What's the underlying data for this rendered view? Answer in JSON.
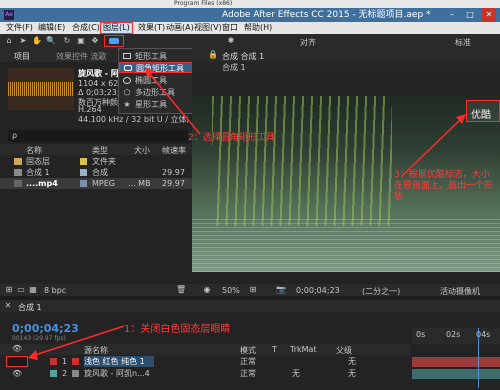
{
  "window": {
    "title": "Adobe After Effects CC 2015 - 无标题项目.aep *",
    "background_path": "Program Files (x86)"
  },
  "menubar": {
    "items": [
      "文件(F)",
      "编辑(E)",
      "合成(C)",
      "图层(L)",
      "效果(T)",
      "动画(A)",
      "视图(V)",
      "窗口",
      "帮助(H)"
    ]
  },
  "toolbar": {
    "snap_label": "对齐",
    "workspace_label": "标准"
  },
  "shape_menu": {
    "items": [
      {
        "label": "矩形工具",
        "shortcut": "Q"
      },
      {
        "label": "圆角矩形工具",
        "shortcut": "Q"
      },
      {
        "label": "椭圆工具",
        "shortcut": "Q"
      },
      {
        "label": "多边形工具",
        "shortcut": "Q"
      },
      {
        "label": "星形工具",
        "shortcut": "Q"
      }
    ]
  },
  "project_panel": {
    "title": "项目",
    "effects_tab": "效果控件 流歌",
    "preview_name": "旋风歌 - 阿凯n",
    "preview_info1": "1104 x 622 (1.",
    "preview_info2": "Δ 0;03;23;07,",
    "preview_info3": "数百万种颜色",
    "preview_info4": "H.264",
    "preview_audio": "44.100 kHz / 32 bit U / 立体声",
    "search_placeholder": "ρ",
    "columns": [
      "名称",
      "类型",
      "大小",
      "帧速率"
    ],
    "rows": [
      {
        "name": "固态层",
        "type": "文件夹",
        "size": "",
        "fps": ""
      },
      {
        "name": "合成 1",
        "type": "合成",
        "size": "",
        "fps": "29.97"
      },
      {
        "name": "....mp4",
        "type": "MPEG",
        "size": "... MB",
        "fps": "29.97"
      }
    ],
    "bpc": "8 bpc"
  },
  "comp_panel": {
    "tab_label": "合成 合成 1",
    "breadcrumb": "合成 1",
    "overlay_text": "优酷",
    "zoom": "50%",
    "timecode": "0;00;04;23",
    "resolution": "(二分之一)",
    "camera": "活动摄像机"
  },
  "timeline": {
    "tab": "合成 1",
    "timecode": "0;00;04;23",
    "frame_info": "00143 (29.97 fps)",
    "columns": [
      "源名称",
      "模式",
      "T",
      "TrkMat",
      "父级"
    ],
    "layers": [
      {
        "num": "1",
        "name": "浅色 红色 纯色 1",
        "mode": "正常",
        "parent": "无"
      },
      {
        "num": "2",
        "name": "旋风歌 - 阿凯n...4",
        "mode": "正常",
        "trkmat": "无",
        "parent": "无"
      }
    ],
    "ruler_labels": [
      "0s",
      "02s",
      "04s"
    ]
  },
  "annotations": {
    "step1": "1：关闭白色固态层眼睛",
    "step2": "2：选择圆角矩形工具",
    "step3": "3：根据优酷标志，大小在原画面上，画出一个形状"
  },
  "colors": {
    "accent_red": "#ff2a2a",
    "title_blue": "#3f6f9d",
    "time_blue": "#4a90e2"
  }
}
